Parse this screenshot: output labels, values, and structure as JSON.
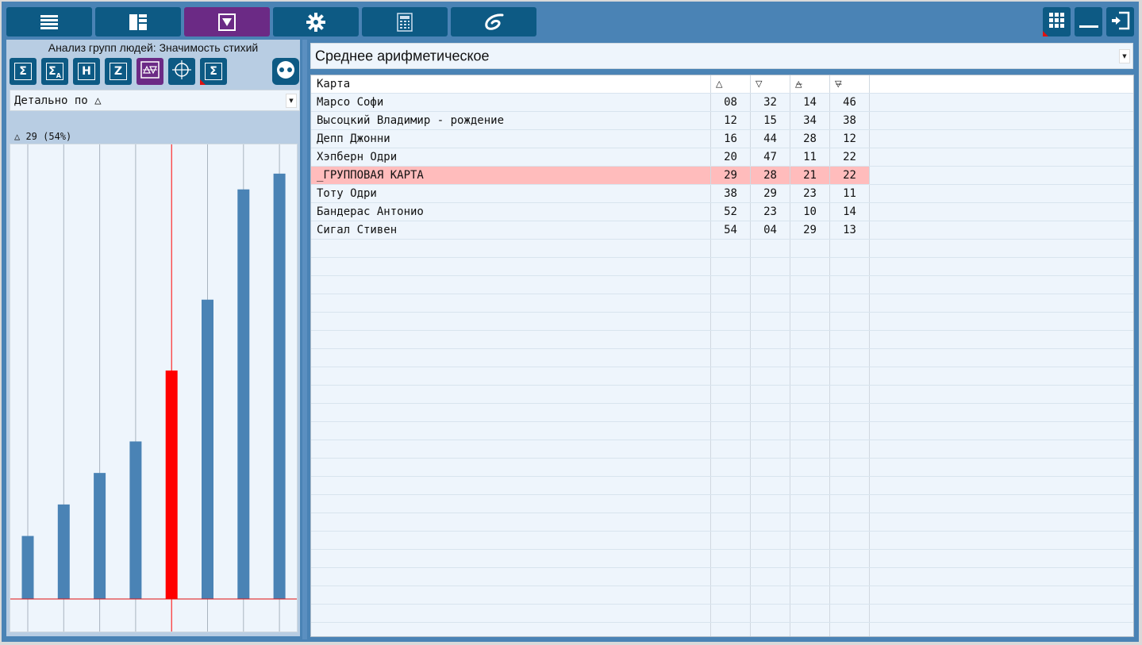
{
  "toolbar": {
    "buttons": [
      {
        "icon": "list-icon"
      },
      {
        "icon": "dashboard-icon"
      },
      {
        "icon": "filter-triangle-icon",
        "active": true
      },
      {
        "icon": "gear-icon"
      },
      {
        "icon": "calculator-icon"
      },
      {
        "icon": "galaxy-icon"
      }
    ],
    "right_buttons": [
      {
        "icon": "grid-icon"
      },
      {
        "icon": "minimize-icon"
      },
      {
        "icon": "exit-icon"
      }
    ]
  },
  "left_panel": {
    "title": "Анализ групп людей: Значимость стихий",
    "tool_icons": [
      {
        "icon": "sigma-icon",
        "glyph": "Σ"
      },
      {
        "icon": "sigma-a-icon",
        "glyph": "Σ",
        "sub": "A"
      },
      {
        "icon": "h-icon",
        "glyph": "H"
      },
      {
        "icon": "z-icon",
        "glyph": "Z"
      },
      {
        "icon": "elements-icon",
        "active": true
      },
      {
        "icon": "chart-wheel-icon"
      },
      {
        "icon": "sigma-doc-icon",
        "glyph": "Σ"
      }
    ],
    "round_button_icon": "yin-yang-icon",
    "detail_dropdown": "Детально по △",
    "chart_label": "△ 29 (54%)"
  },
  "chart_data": {
    "type": "bar",
    "series_values": [
      8,
      12,
      16,
      20,
      29,
      38,
      52,
      54
    ],
    "highlight_index": 4,
    "bar_color": "#4a83b5",
    "highlight_color": "#ff0000",
    "ylim": [
      0,
      56
    ],
    "grid": true
  },
  "right_panel": {
    "stat_dropdown": "Среднее арифметическое",
    "table": {
      "headers": [
        "Карта",
        "△",
        "▽",
        "△̶",
        "▽̶"
      ],
      "rows": [
        [
          "Марсо Софи",
          "08",
          "32",
          "14",
          "46"
        ],
        [
          "Высоцкий Владимир - рождение",
          "12",
          "15",
          "34",
          "38"
        ],
        [
          "Депп Джонни",
          "16",
          "44",
          "28",
          "12"
        ],
        [
          "Хэпберн Одри",
          "20",
          "47",
          "11",
          "22"
        ],
        [
          "_ГРУППОВАЯ КАРТА",
          "29",
          "28",
          "21",
          "22"
        ],
        [
          "Тоту Одри",
          "38",
          "29",
          "23",
          "11"
        ],
        [
          "Бандерас Антонио",
          "52",
          "23",
          "10",
          "14"
        ],
        [
          "Сигал Стивен",
          "54",
          "04",
          "29",
          "13"
        ]
      ],
      "highlight_row": 4
    }
  }
}
